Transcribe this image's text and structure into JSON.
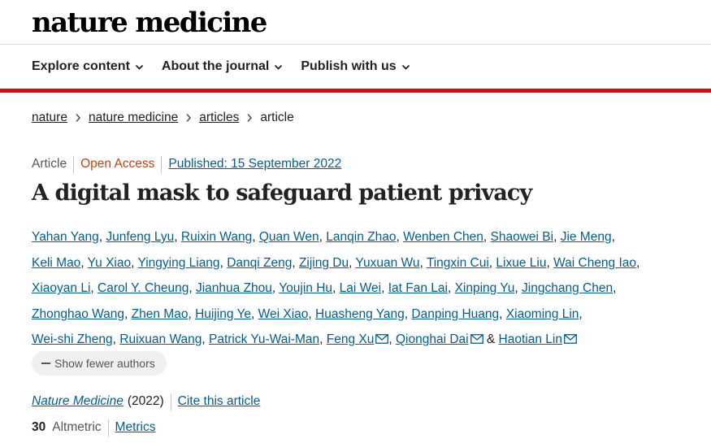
{
  "header": {
    "logo": "nature medicine",
    "nav": [
      {
        "label": "Explore content"
      },
      {
        "label": "About the journal"
      },
      {
        "label": "Publish with us"
      }
    ]
  },
  "breadcrumb": [
    "nature",
    "nature medicine",
    "articles",
    "article"
  ],
  "article": {
    "type": "Article",
    "access": "Open Access",
    "published": "Published: 15 September 2022",
    "title": "A digital mask to safeguard patient privacy",
    "authors": [
      "Yahan Yang",
      "Junfeng Lyu",
      "Ruixin Wang",
      "Quan Wen",
      "Lanqin Zhao",
      "Wenben Chen",
      "Shaowei Bi",
      "Jie Meng",
      "Keli Mao",
      "Yu Xiao",
      "Yingying Liang",
      "Danqi Zeng",
      "Zijing Du",
      "Yuxuan Wu",
      "Tingxin Cui",
      "Lixue Liu",
      "Wai Cheng Iao",
      "Xiaoyan Li",
      "Carol Y. Cheung",
      "Jianhua Zhou",
      "Youjin Hu",
      "Lai Wei",
      "Iat Fan Lai",
      "Xinping Yu",
      "Jingchang Chen",
      "Zhonghao Wang",
      "Zhen Mao",
      "Huijing Ye",
      "Wei Xiao",
      "Huasheng Yang",
      "Danping Huang",
      "Xiaoming Lin",
      "Wei-shi Zheng",
      "Ruixuan Wang",
      "Patrick Yu-Wai-Man",
      "Feng Xu",
      "Qionghai Dai",
      "Haotian Lin"
    ],
    "corresponding": [
      "Feng Xu",
      "Qionghai Dai",
      "Haotian Lin"
    ],
    "show_fewer": "Show fewer authors",
    "journal": "Nature Medicine",
    "year": "(2022)",
    "cite": "Cite this article",
    "altmetric_score": "30",
    "altmetric_label": "Altmetric",
    "metrics": "Metrics"
  },
  "colors": {
    "accent_red": "#e0001a",
    "link": "#025e8d",
    "open_access": "#b74616"
  }
}
